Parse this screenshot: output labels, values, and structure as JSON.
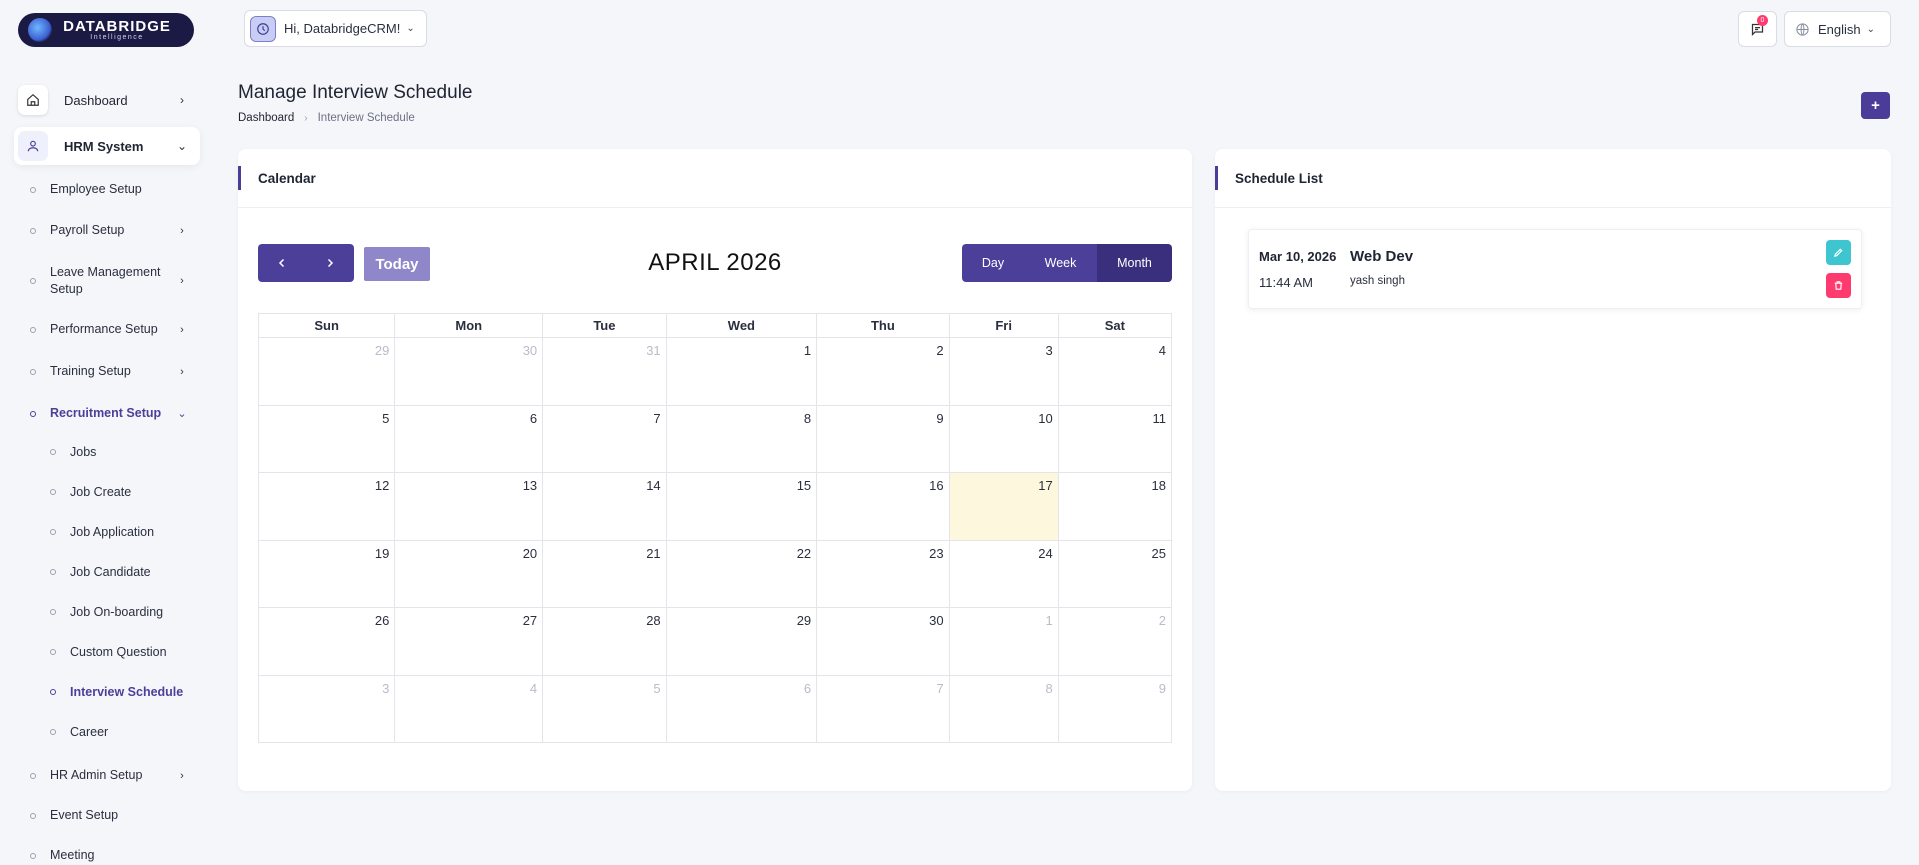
{
  "brand": {
    "name": "DATABRIDGE",
    "tagline": "Intelligence"
  },
  "header": {
    "greeting": "Hi, DatabridgeCRM!",
    "notification_count": "0",
    "language": "English"
  },
  "sidebar": {
    "dashboard": "Dashboard",
    "hrm": "HRM System",
    "items": [
      "Employee Setup",
      "Payroll Setup",
      "Leave Management Setup",
      "Performance Setup",
      "Training Setup",
      "Recruitment Setup",
      "HR Admin Setup",
      "Event Setup",
      "Meeting"
    ],
    "recruitment_children": [
      "Jobs",
      "Job Create",
      "Job Application",
      "Job Candidate",
      "Job On-boarding",
      "Custom Question",
      "Interview Schedule",
      "Career"
    ]
  },
  "page": {
    "title": "Manage Interview Schedule",
    "breadcrumb": [
      "Dashboard",
      "Interview Schedule"
    ],
    "add_label": "+"
  },
  "calendar": {
    "card_title": "Calendar",
    "title": "APRIL 2026",
    "today_label": "Today",
    "views": [
      "Day",
      "Week",
      "Month"
    ],
    "active_view": "Month",
    "weekdays": [
      "Sun",
      "Mon",
      "Tue",
      "Wed",
      "Thu",
      "Fri",
      "Sat"
    ],
    "weeks": [
      [
        "29",
        "30",
        "31",
        "1",
        "2",
        "3",
        "4"
      ],
      [
        "5",
        "6",
        "7",
        "8",
        "9",
        "10",
        "11"
      ],
      [
        "12",
        "13",
        "14",
        "15",
        "16",
        "17",
        "18"
      ],
      [
        "19",
        "20",
        "21",
        "22",
        "23",
        "24",
        "25"
      ],
      [
        "26",
        "27",
        "28",
        "29",
        "30",
        "1",
        "2"
      ],
      [
        "3",
        "4",
        "5",
        "6",
        "7",
        "8",
        "9"
      ]
    ],
    "today_cell": "17"
  },
  "schedule": {
    "card_title": "Schedule List",
    "items": [
      {
        "date": "Mar 10, 2026",
        "time": "11:44 AM",
        "title": "Web Dev",
        "person": "yash singh"
      }
    ]
  },
  "colors": {
    "primary": "#4c3f9a",
    "today_bg": "#fdf7dd",
    "edit": "#3ec5d0",
    "delete": "#ff3a6e"
  }
}
